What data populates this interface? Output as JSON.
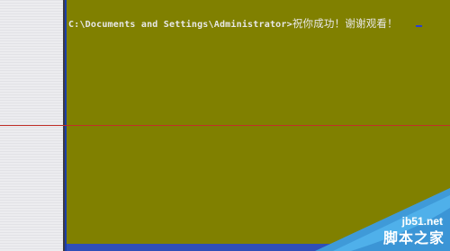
{
  "console": {
    "prompt_path": "C:\\Documents and Settings\\Administrator>",
    "typed_text": "祝你成功！谢谢观看！",
    "background_color": "#808000",
    "text_color": "#e8e8e8"
  },
  "watermark": {
    "site": "jb51.net",
    "name": "脚本之家"
  }
}
